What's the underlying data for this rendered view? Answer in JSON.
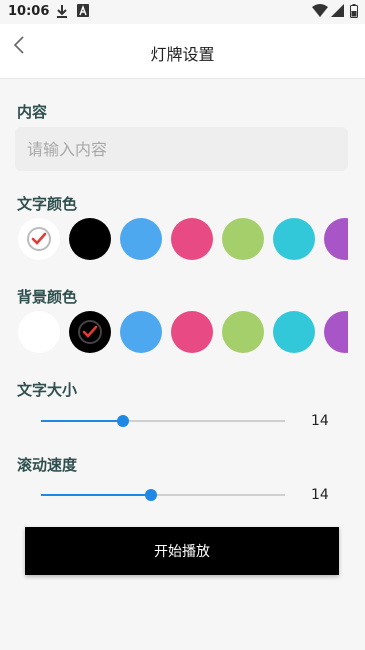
{
  "status_bar": {
    "time": "10:06",
    "icons": [
      "download-icon",
      "app-a-icon",
      "wifi-icon",
      "signal-icon",
      "battery-icon"
    ]
  },
  "toolbar": {
    "back_icon": "chevron-left-icon",
    "title": "灯牌设置"
  },
  "content": {
    "label": "内容",
    "placeholder": "请输入内容",
    "value": ""
  },
  "text_color": {
    "label": "文字颜色",
    "selected_index": 0,
    "swatches": [
      "#ffffff",
      "#000000",
      "#4da8f0",
      "#e84a83",
      "#a4cf6a",
      "#33c8d9",
      "#a855c8"
    ]
  },
  "bg_color": {
    "label": "背景颜色",
    "selected_index": 1,
    "swatches": [
      "#ffffff",
      "#000000",
      "#4da8f0",
      "#e84a83",
      "#a4cf6a",
      "#33c8d9",
      "#a855c8"
    ]
  },
  "text_size": {
    "label": "文字大小",
    "value": "14",
    "level": 0.335
  },
  "scroll_speed": {
    "label": "滚动速度",
    "value": "14",
    "level": 0.45
  },
  "play_button": {
    "label": "开始播放"
  },
  "colors": {
    "accent": "#1e88e5",
    "check": "#e53935"
  }
}
